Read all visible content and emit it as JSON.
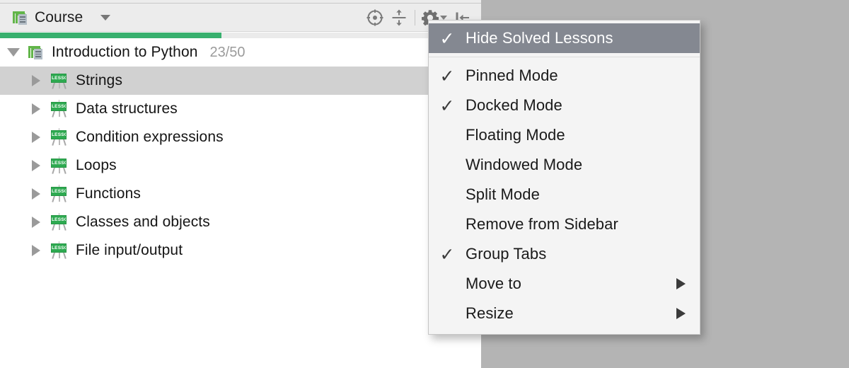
{
  "window": {
    "background_color": "#b4b4b4"
  },
  "tool_window": {
    "title": "Course",
    "icon": "course-icon",
    "title_dropdown_icon": "chevron-down-icon",
    "actions": [
      {
        "name": "scroll-from-source-button",
        "icon": "target-icon",
        "tooltip": "Scroll from Source"
      },
      {
        "name": "collapse-all-button",
        "icon": "collapse-all-icon",
        "tooltip": "Collapse All"
      },
      {
        "name": "settings-button",
        "icon": "gear-icon",
        "tooltip": "Settings"
      },
      {
        "name": "hide-button",
        "icon": "hide-sidebar-icon",
        "tooltip": "Hide"
      }
    ],
    "progress": {
      "percent": 46,
      "fill_color": "#38b06e",
      "track_color": "#ebebeb"
    }
  },
  "tree": {
    "root": {
      "label": "Introduction to Python",
      "count": "23/50",
      "expanded": true,
      "icon": "course-icon"
    },
    "lessons": [
      {
        "label": "Strings",
        "icon": "lesson-icon",
        "icon_text": "LESSON",
        "selected": true,
        "expanded": false
      },
      {
        "label": "Data structures",
        "icon": "lesson-icon",
        "icon_text": "LESSON",
        "selected": false,
        "expanded": false
      },
      {
        "label": "Condition expressions",
        "icon": "lesson-icon",
        "icon_text": "LESSON",
        "selected": false,
        "expanded": false
      },
      {
        "label": "Loops",
        "icon": "lesson-icon",
        "icon_text": "LESSON",
        "selected": false,
        "expanded": false
      },
      {
        "label": "Functions",
        "icon": "lesson-icon",
        "icon_text": "LESSON",
        "selected": false,
        "expanded": false
      },
      {
        "label": "Classes and objects",
        "icon": "lesson-icon",
        "icon_text": "LESSON",
        "selected": false,
        "expanded": false
      },
      {
        "label": "File input/output",
        "icon": "lesson-icon",
        "icon_text": "LESSON",
        "selected": false,
        "expanded": false
      }
    ]
  },
  "popup_menu": {
    "highlight_color": "#848891",
    "background_color": "#f4f4f4",
    "check_glyph": "✓",
    "items": [
      {
        "label": "Hide Solved Lessons",
        "checked": true,
        "highlighted": true,
        "submenu": false
      },
      {
        "separator": true
      },
      {
        "label": "Pinned Mode",
        "checked": true,
        "highlighted": false,
        "submenu": false
      },
      {
        "label": "Docked Mode",
        "checked": true,
        "highlighted": false,
        "submenu": false
      },
      {
        "label": "Floating Mode",
        "checked": false,
        "highlighted": false,
        "submenu": false
      },
      {
        "label": "Windowed Mode",
        "checked": false,
        "highlighted": false,
        "submenu": false
      },
      {
        "label": "Split Mode",
        "checked": false,
        "highlighted": false,
        "submenu": false
      },
      {
        "label": "Remove from Sidebar",
        "checked": false,
        "highlighted": false,
        "submenu": false
      },
      {
        "label": "Group Tabs",
        "checked": true,
        "highlighted": false,
        "submenu": false
      },
      {
        "label": "Move to",
        "checked": false,
        "highlighted": false,
        "submenu": true
      },
      {
        "label": "Resize",
        "checked": false,
        "highlighted": false,
        "submenu": true
      }
    ]
  }
}
